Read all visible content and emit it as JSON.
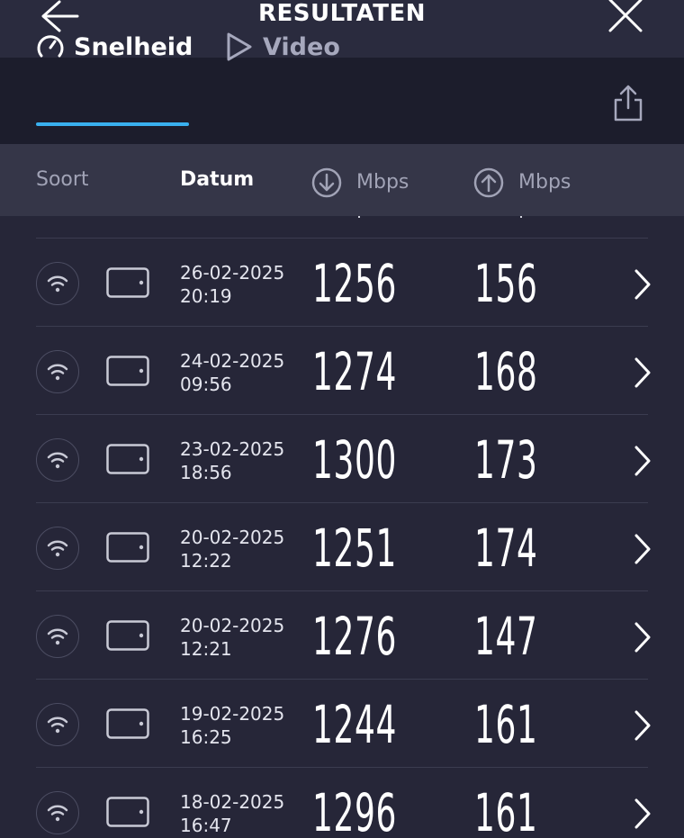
{
  "header": {
    "title": "RESULTATEN"
  },
  "tabs": [
    {
      "label": "Snelheid",
      "active": true,
      "icon": "speedometer-icon"
    },
    {
      "label": "Video",
      "active": false,
      "icon": "play-icon"
    }
  ],
  "columns": {
    "sort": "Soort",
    "date": "Datum",
    "download": "Mbps",
    "upload": "Mbps"
  },
  "colors": {
    "background": "#262638",
    "accent": "#39b0ef"
  },
  "results": [
    {
      "date": "26-02-2025",
      "time": "20:19",
      "download": "1256",
      "upload": "156"
    },
    {
      "date": "24-02-2025",
      "time": "09:56",
      "download": "1274",
      "upload": "168"
    },
    {
      "date": "23-02-2025",
      "time": "18:56",
      "download": "1300",
      "upload": "173"
    },
    {
      "date": "20-02-2025",
      "time": "12:22",
      "download": "1251",
      "upload": "174"
    },
    {
      "date": "20-02-2025",
      "time": "12:21",
      "download": "1276",
      "upload": "147"
    },
    {
      "date": "19-02-2025",
      "time": "16:25",
      "download": "1244",
      "upload": "161"
    },
    {
      "date": "18-02-2025",
      "time": "16:47",
      "download": "1296",
      "upload": "161"
    }
  ]
}
